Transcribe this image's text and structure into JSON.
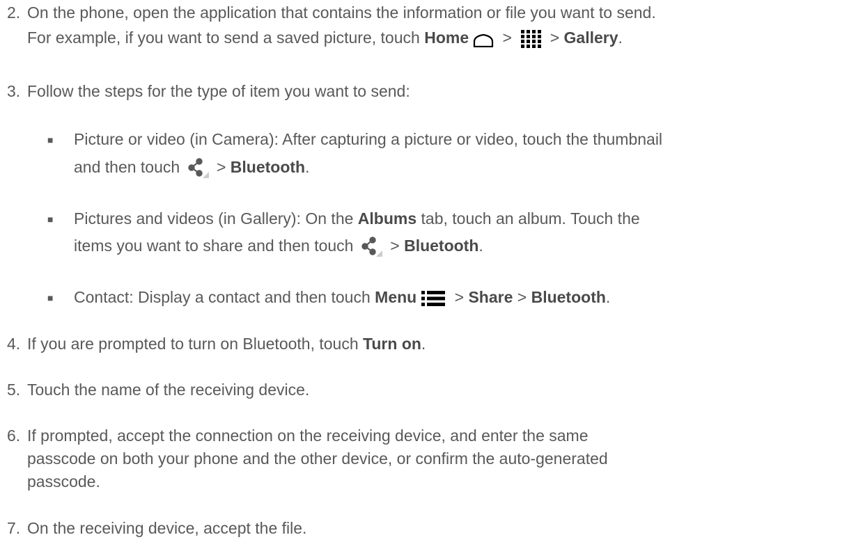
{
  "steps": {
    "s2": {
      "num": "2.",
      "line1": "On the phone, open the application that contains the information or file you want to send.",
      "line2a": "For example, if you want to send a saved picture, touch ",
      "home": "Home",
      "sep1": " > ",
      "sep2": " > ",
      "gallery": "Gallery",
      "end": "."
    },
    "s3": {
      "num": "3.",
      "text": "Follow the steps for the type of item you want to send:",
      "b1": {
        "line1": "Picture or video (in Camera): After capturing a picture or video, touch the thumbnail",
        "line2a": "and then touch ",
        "sep": " > ",
        "bluetooth": "Bluetooth",
        "end": "."
      },
      "b2": {
        "line1a": "Pictures and videos (in Gallery): On the ",
        "albums": "Albums",
        "line1b": " tab, touch an album. Touch the",
        "line2a": "items you want to share and then touch ",
        "sep": " > ",
        "bluetooth": "Bluetooth",
        "end": "."
      },
      "b3": {
        "text_a": "Contact: Display a contact and then touch ",
        "menu": "Menu",
        "sep1": " > ",
        "share": "Share",
        "sep2": " > ",
        "bluetooth": "Bluetooth",
        "end": "."
      }
    },
    "s4": {
      "num": "4.",
      "text": "If you are prompted to turn on Bluetooth, touch ",
      "turn_on": "Turn on",
      "end": "."
    },
    "s5": {
      "num": "5.",
      "text": "Touch the name of the receiving device."
    },
    "s6": {
      "num": "6.",
      "line1": "If prompted, accept the connection on the receiving device, and enter the same",
      "line2": "passcode on both your phone and the other device, or confirm the auto-generated",
      "line3": "passcode."
    },
    "s7": {
      "num": "7.",
      "text": "On the receiving device, accept the file."
    }
  },
  "icons": {
    "home": "home-icon",
    "apps": "apps-icon",
    "share": "share-icon",
    "menu": "menu-icon"
  },
  "colors": {
    "text": "#595959",
    "bold": "#4a4a4a",
    "icon": "#000000"
  }
}
